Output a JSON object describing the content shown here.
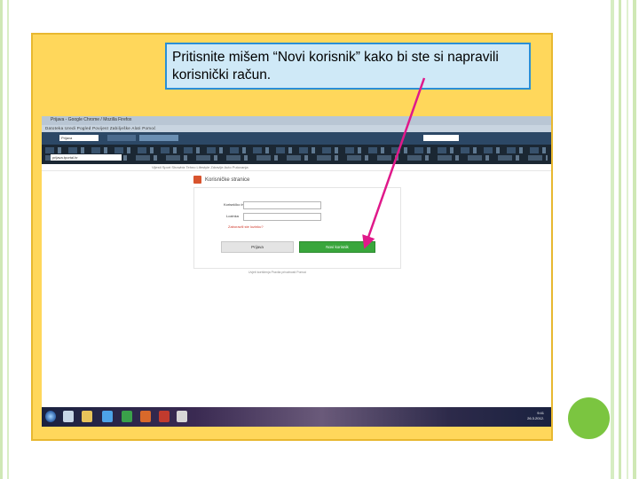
{
  "slide": {
    "callout_text": "Pritisnite mišem “Novi korisnik” kako bi ste si napravili korisnički račun.",
    "accent_color": "#e0198a",
    "frame_color": "#ffd75b",
    "circle_color": "#7bc540"
  },
  "browser": {
    "window_title": "Prijava - Google Chrome / Mozilla Firefox",
    "menu_text": "Datoteka  Uredi  Pogled  Povijest  Zabilješke  Alati  Pomoć",
    "url_short": "Prijava",
    "address": "prijava.tportal.hr",
    "portal_nav": "Vijesti  Sport  Showbiz  Tehno  Lifestyle  Zdravlje  Auto  Putovanja"
  },
  "login_page": {
    "header": "Korisničke stranice",
    "username_label": "Korisničko ime",
    "password_label": "Lozinka",
    "forgot_link": "Zaboravili ste lozinku?",
    "login_button": "Prijava",
    "new_user_button": "Novi korisnik",
    "footer": "Uvjeti korištenja     Pravila privatnosti     Pomoć"
  },
  "taskbar": {
    "time": "9:41",
    "date": "26.3.2012."
  }
}
